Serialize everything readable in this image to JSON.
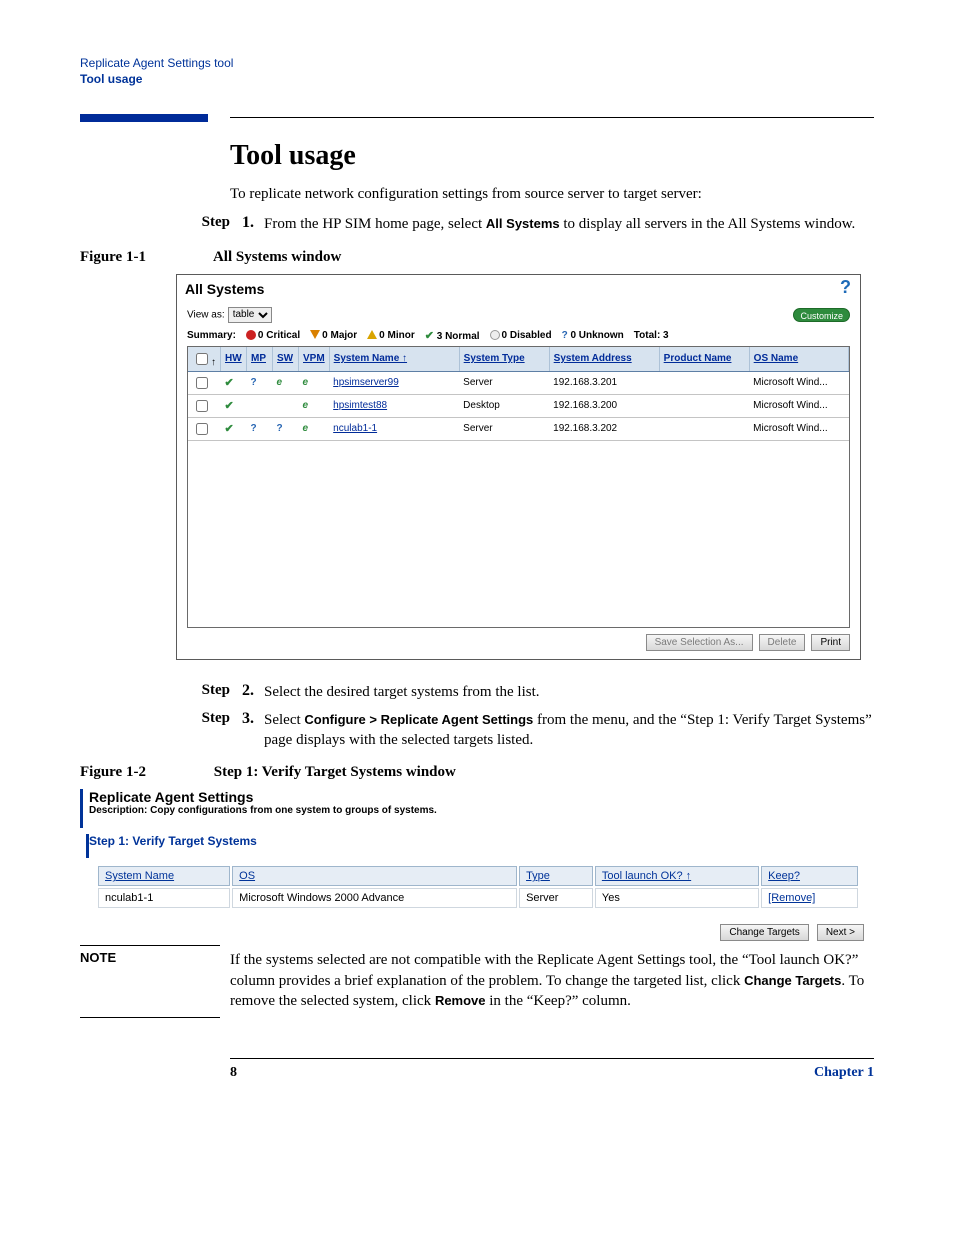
{
  "header": {
    "title": "Replicate Agent Settings tool",
    "subtitle": "Tool usage"
  },
  "section": {
    "heading": "Tool usage",
    "intro": "To replicate network configuration settings from source server to target server:"
  },
  "steps": {
    "label": "Step",
    "s1": {
      "num": "1.",
      "pre": "From the HP SIM home page, select ",
      "bold": "All Systems",
      "post": " to display all servers in the All Systems window."
    },
    "s2": {
      "num": "2.",
      "text": "Select the desired target systems from the list."
    },
    "s3": {
      "num": "3.",
      "pre": "Select ",
      "bold": "Configure > Replicate Agent Settings",
      "post": " from the menu, and the “Step 1: Verify Target Systems” page displays with the selected targets listed."
    }
  },
  "figure1": {
    "label": "Figure 1-1",
    "caption": "All Systems window",
    "window_title": "All Systems",
    "viewas": "View as:",
    "viewas_value": "table",
    "customize": "Customize",
    "summary_label": "Summary:",
    "summary": {
      "critical": "0 Critical",
      "major": "0 Major",
      "minor": "0 Minor",
      "normal": "3 Normal",
      "disabled": "0 Disabled",
      "unknown": "0 Unknown",
      "total": "Total: 3"
    },
    "cols": {
      "hw": "HW",
      "mp": "MP",
      "sw": "SW",
      "vpm": "VPM",
      "sysname": "System Name ↑",
      "systype": "System Type",
      "sysaddr": "System Address",
      "prodname": "Product Name",
      "osname": "OS Name"
    },
    "rows": [
      {
        "hw": "ok",
        "mp": "q",
        "sw": "it",
        "vpm": "it",
        "name": "hpsimserver99",
        "type": "Server",
        "addr": "192.168.3.201",
        "prod": "",
        "os": "Microsoft Wind..."
      },
      {
        "hw": "ok",
        "mp": "",
        "sw": "",
        "vpm": "it",
        "name": "hpsimtest88",
        "type": "Desktop",
        "addr": "192.168.3.200",
        "prod": "",
        "os": "Microsoft Wind..."
      },
      {
        "hw": "ok",
        "mp": "q",
        "sw": "q",
        "vpm": "it",
        "name": "nculab1-1",
        "type": "Server",
        "addr": "192.168.3.202",
        "prod": "",
        "os": "Microsoft Wind..."
      }
    ],
    "buttons": {
      "save": "Save Selection As...",
      "delete": "Delete",
      "print": "Print"
    }
  },
  "figure2": {
    "label": "Figure 1-2",
    "caption": "Step 1: Verify Target Systems window",
    "title": "Replicate Agent Settings",
    "desc": "Description: Copy configurations from one system to groups of systems.",
    "step_title": "Step 1: Verify Target Systems",
    "cols": {
      "sysname": "System Name",
      "os": "OS",
      "type": "Type",
      "launch": "Tool launch OK? ↑",
      "keep": "Keep?"
    },
    "row": {
      "name": "nculab1-1",
      "os": "Microsoft Windows 2000 Advance",
      "type": "Server",
      "launch": "Yes",
      "keep": "[Remove]"
    },
    "buttons": {
      "change": "Change Targets",
      "next": "Next >"
    }
  },
  "note": {
    "label": "NOTE",
    "t1": "If the systems selected are not compatible with the Replicate Agent Settings tool, the “Tool launch OK?” column provides a brief explanation of the problem. To change the targeted list, click ",
    "b1": "Change Targets",
    "t2": ". To remove the selected system, click ",
    "b2": "Remove",
    "t3": " in the “Keep?” column."
  },
  "footer": {
    "page": "8",
    "chapter": "Chapter 1"
  }
}
